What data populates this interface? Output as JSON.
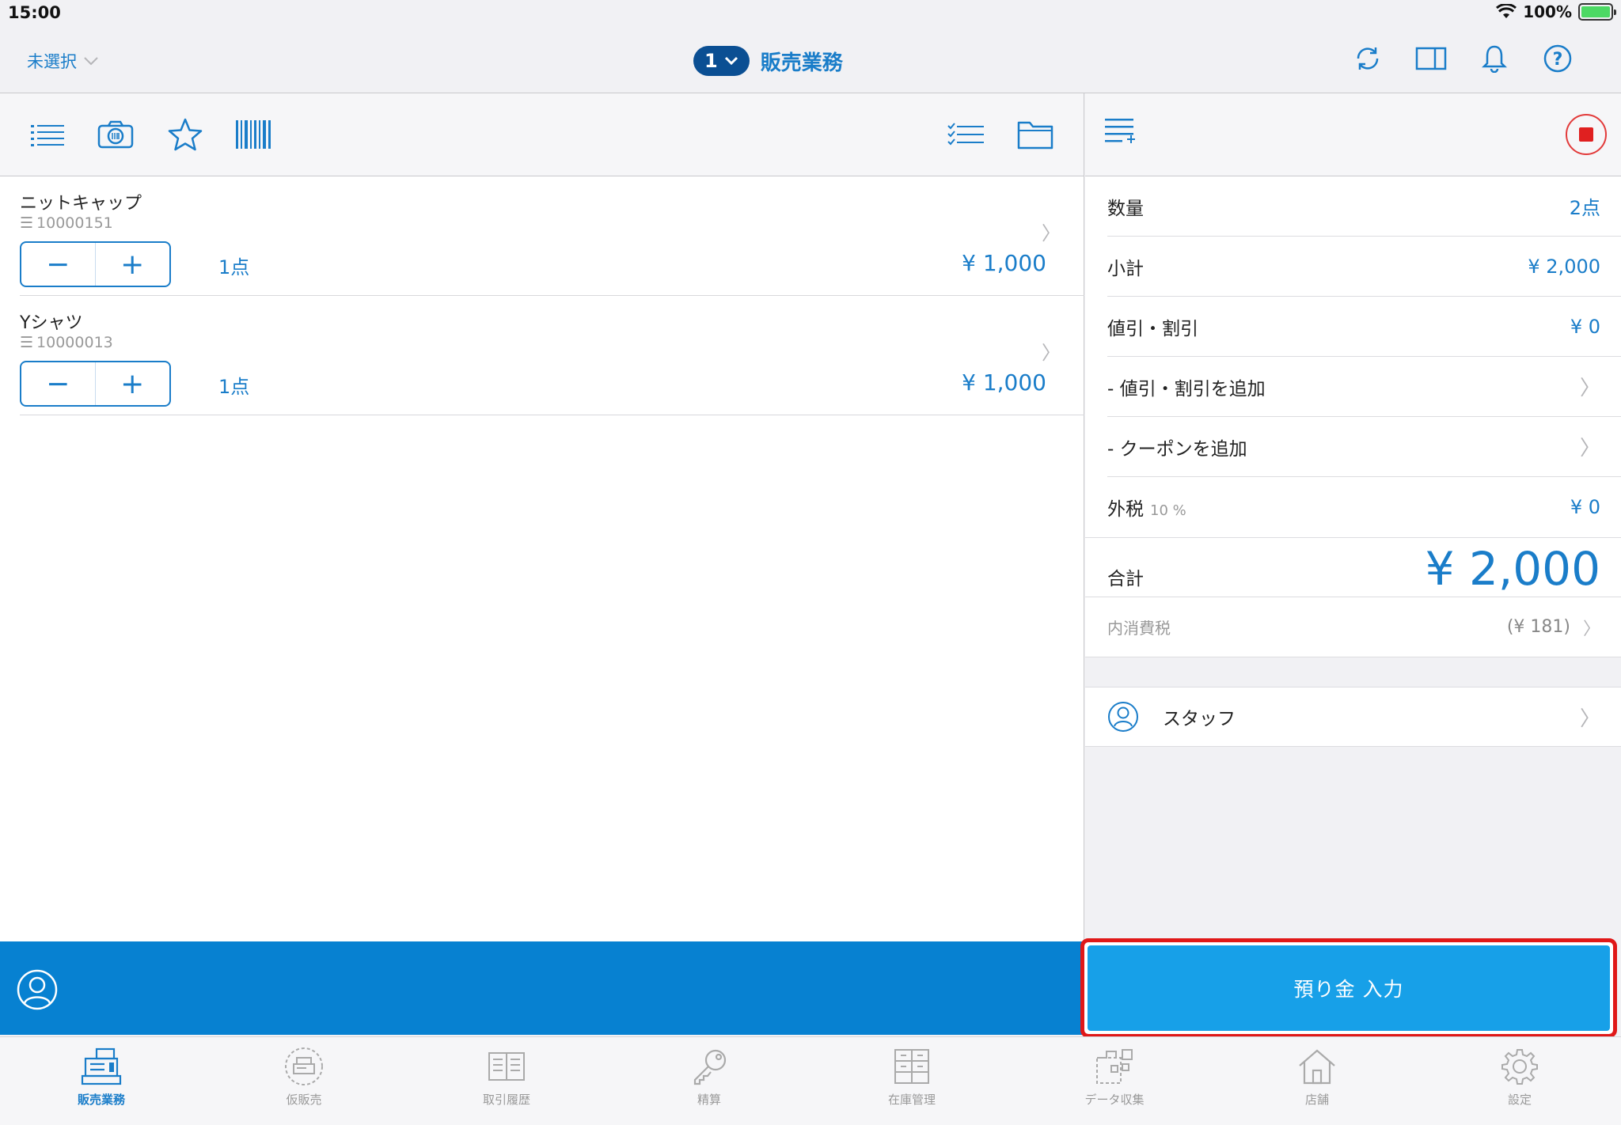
{
  "status": {
    "time": "15:00",
    "battery": "100%"
  },
  "nav": {
    "left_label": "未選択",
    "register_number": "1",
    "title": "販売業務"
  },
  "items": [
    {
      "name": "ニットキャップ",
      "code": "10000151",
      "qty": "1点",
      "price": "¥ 1,000"
    },
    {
      "name": "Yシャツ",
      "code": "10000013",
      "qty": "1点",
      "price": "¥ 1,000"
    }
  ],
  "summary": {
    "quantity_label": "数量",
    "quantity_value": "2点",
    "subtotal_label": "小計",
    "subtotal_value": "¥ 2,000",
    "discount_label": "値引・割引",
    "discount_value": "¥ 0",
    "add_discount_label": "- 値引・割引を追加",
    "add_coupon_label": "- クーポンを追加",
    "tax_label": "外税",
    "tax_rate": "10 %",
    "tax_value": "¥ 0",
    "total_label": "合計",
    "total_value": "¥ 2,000",
    "inner_tax_label": "内消費税",
    "inner_tax_value": "(¥ 181)"
  },
  "staff": {
    "label": "スタッフ"
  },
  "deposit_button": "預り金 入力",
  "tabs": [
    {
      "label": "販売業務",
      "icon": "register-icon",
      "active": true
    },
    {
      "label": "仮販売",
      "icon": "temp-sale-icon"
    },
    {
      "label": "取引履歴",
      "icon": "history-book-icon"
    },
    {
      "label": "精算",
      "icon": "key-icon"
    },
    {
      "label": "在庫管理",
      "icon": "inventory-icon"
    },
    {
      "label": "データ収集",
      "icon": "data-collect-icon"
    },
    {
      "label": "店舗",
      "icon": "store-icon"
    },
    {
      "label": "設定",
      "icon": "gear-icon"
    }
  ],
  "colors": {
    "accent": "#1a7dc9",
    "bottom_bar": "#0781d1",
    "deposit": "#17a0e8",
    "highlight": "#e01818"
  }
}
